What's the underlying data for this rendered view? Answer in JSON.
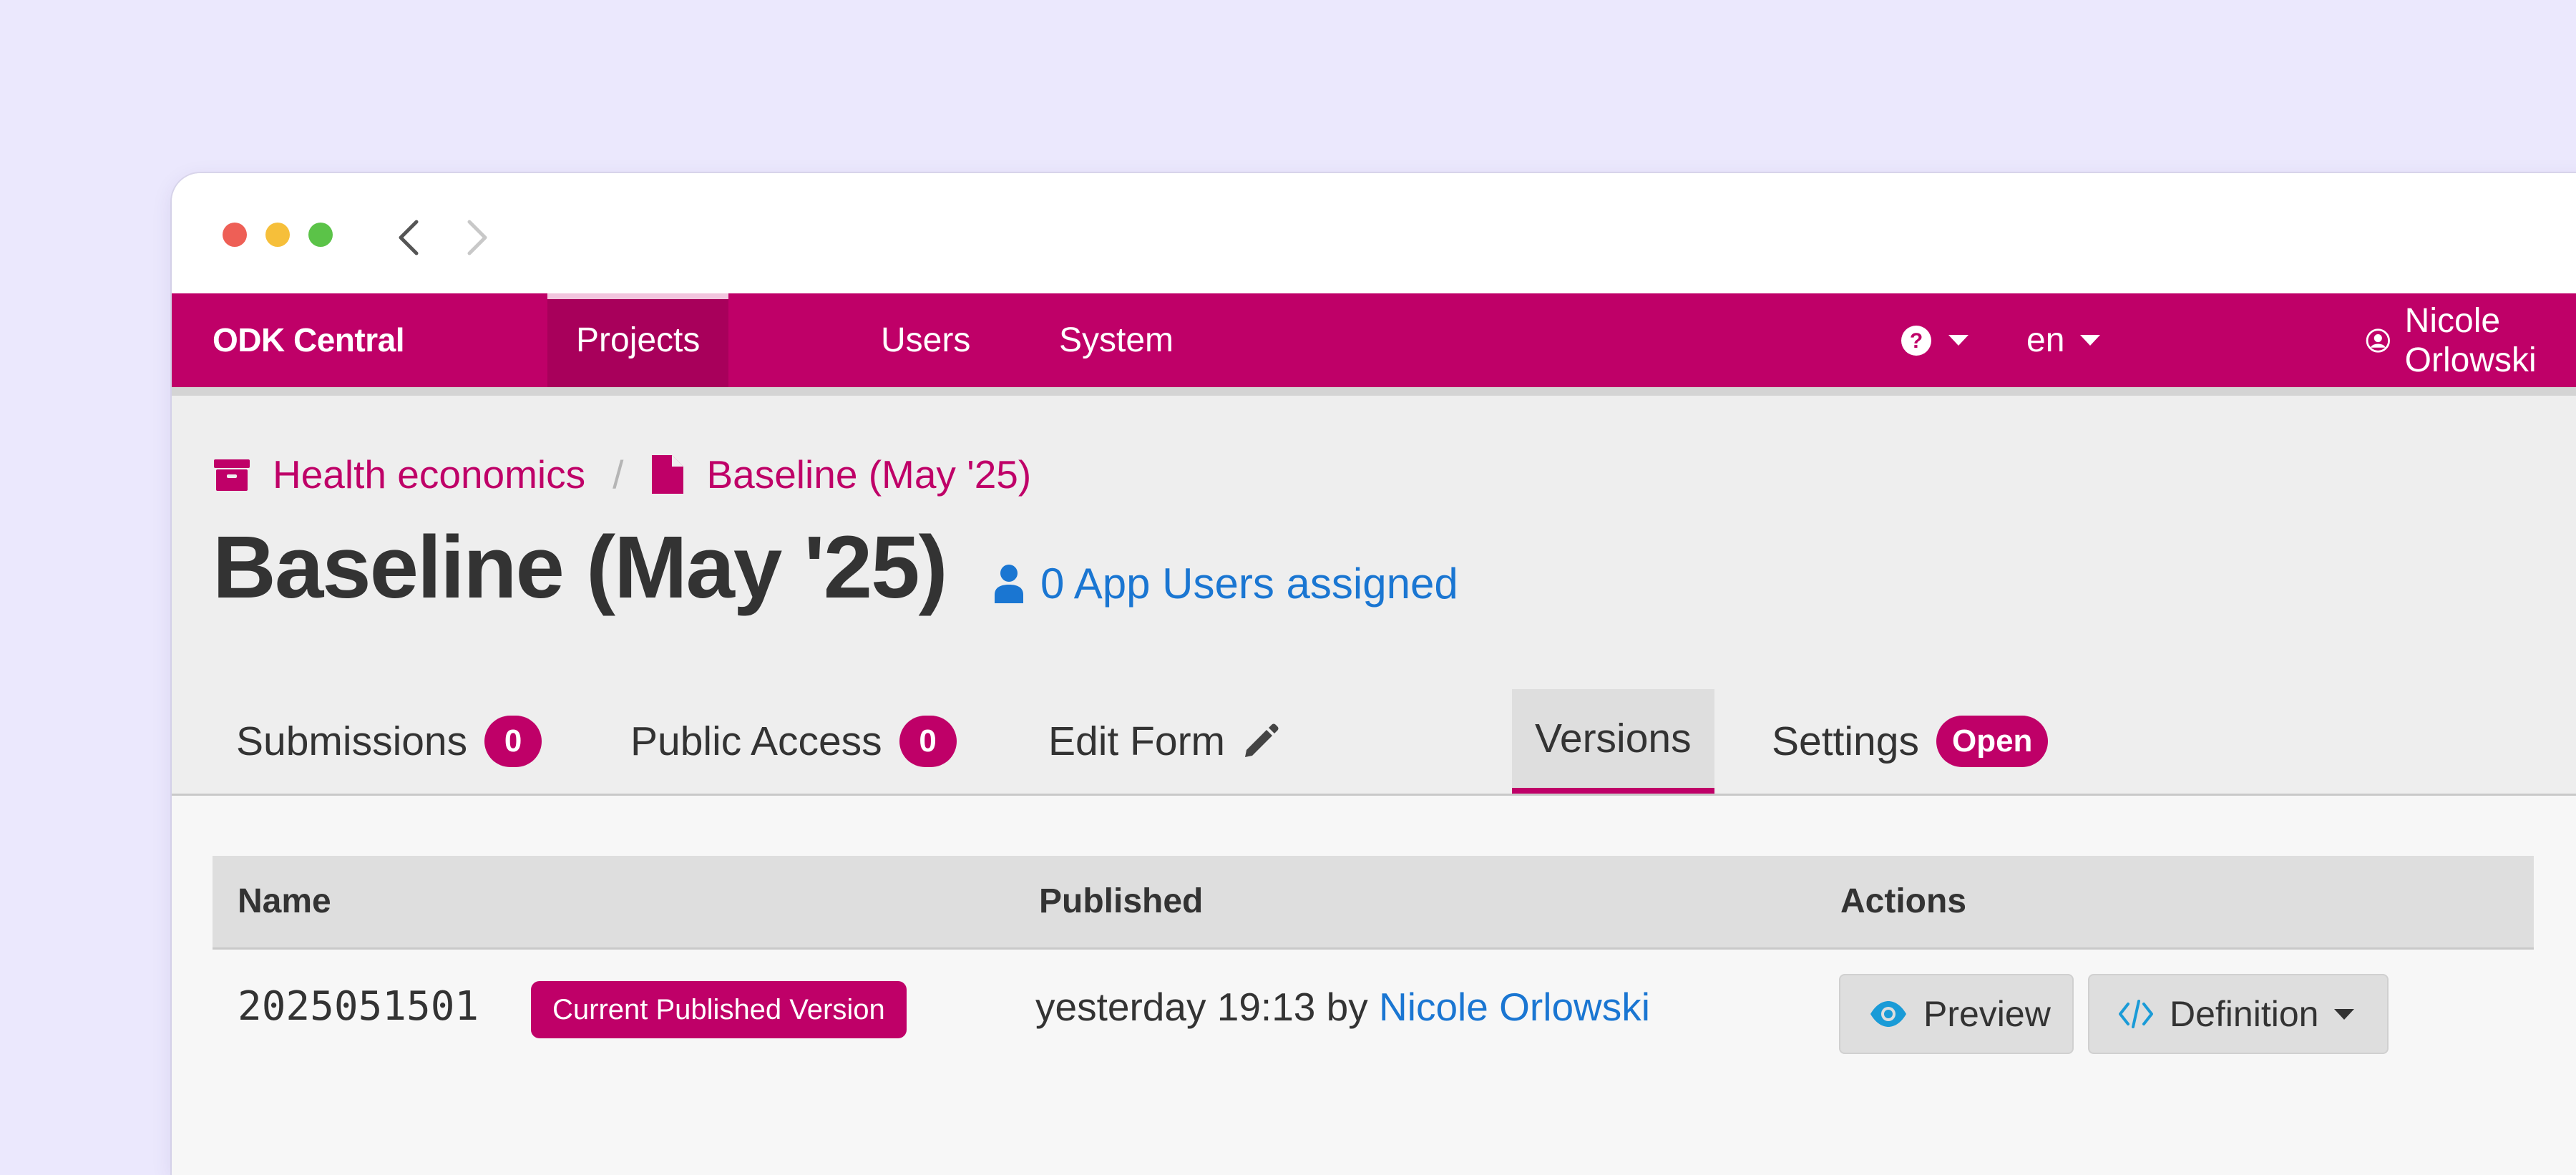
{
  "navbar": {
    "brand": "ODK Central",
    "items": [
      {
        "label": "Projects",
        "active": true
      },
      {
        "label": "Users",
        "active": false
      },
      {
        "label": "System",
        "active": false
      }
    ],
    "language": "en",
    "user_name": "Nicole Orlowski"
  },
  "breadcrumb": {
    "project": "Health economics",
    "separator": "/",
    "form": "Baseline (May '25)"
  },
  "page": {
    "title": "Baseline (May '25)",
    "app_users_link": "0 App Users assigned"
  },
  "tabs": [
    {
      "label": "Submissions",
      "badge": "0"
    },
    {
      "label": "Public Access",
      "badge": "0"
    },
    {
      "label": "Edit Form"
    },
    {
      "label": "Versions",
      "active": true
    },
    {
      "label": "Settings",
      "badge": "Open"
    }
  ],
  "table": {
    "columns": [
      "Name",
      "Published",
      "Actions"
    ],
    "rows": [
      {
        "name": "2025051501",
        "badge": "Current Published Version",
        "published_time": "yesterday 19:13 by",
        "published_by": "Nicole Orlowski",
        "actions": {
          "preview": "Preview",
          "definition": "Definition"
        }
      }
    ]
  },
  "colors": {
    "brand": "#bf0068",
    "link": "#1a76d2",
    "background": "#ebe8fd"
  }
}
